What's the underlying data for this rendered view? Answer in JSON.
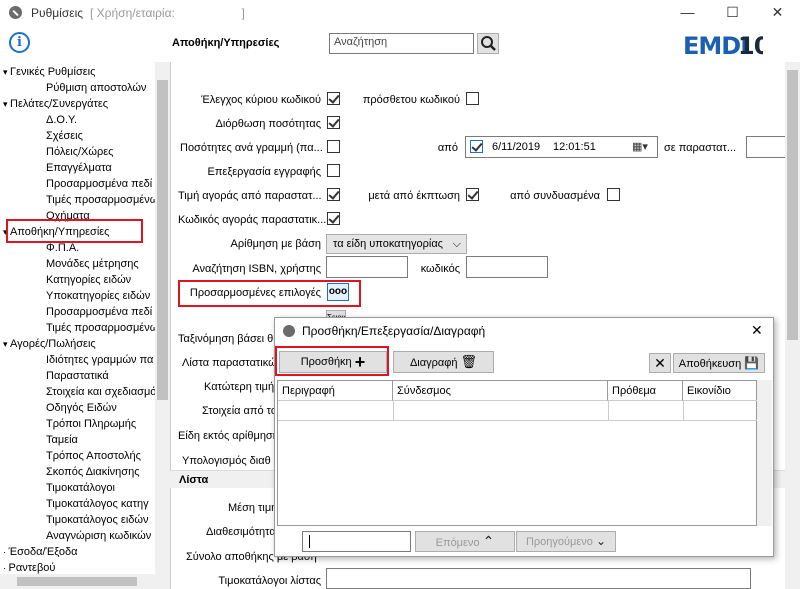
{
  "window": {
    "title": "Ρυθμίσεις",
    "subtitle": "[ Χρήση/εταιρία:                    ]",
    "minimize": "—",
    "maximize": "☐",
    "close": "✕"
  },
  "toolbar": {
    "section_label": "Αποθήκη/Υπηρεσίες",
    "search_placeholder": "Αναζήτηση",
    "logo": "EMDI10",
    "logo_color": "#1a5fb4"
  },
  "tree": {
    "items": [
      {
        "label": "Γενικές Ρυθμίσεις",
        "level": 0,
        "expanded": true
      },
      {
        "label": "Ρύθμιση αποστολών",
        "level": 1
      },
      {
        "label": "Πελάτες/Συνεργάτες",
        "level": 0,
        "expanded": true
      },
      {
        "label": "Δ.Ο.Υ.",
        "level": 1
      },
      {
        "label": "Σχέσεις",
        "level": 1
      },
      {
        "label": "Πόλεις/Χώρες",
        "level": 1
      },
      {
        "label": "Επαγγέλματα",
        "level": 1
      },
      {
        "label": "Προσαρμοσμένα πεδί",
        "level": 1
      },
      {
        "label": "Τιμές προσαρμοσμένω",
        "level": 1
      },
      {
        "label": "Οχήματα",
        "level": 1
      },
      {
        "label": "Αποθήκη/Υπηρεσίες",
        "level": 0,
        "expanded": true
      },
      {
        "label": "Φ.Π.Α.",
        "level": 1
      },
      {
        "label": "Μονάδες μέτρησης",
        "level": 1
      },
      {
        "label": "Κατηγορίες ειδών",
        "level": 1
      },
      {
        "label": "Υποκατηγορίες ειδών",
        "level": 1
      },
      {
        "label": "Προσαρμοσμένα πεδί",
        "level": 1
      },
      {
        "label": "Τιμές προσαρμοσμένω",
        "level": 1
      },
      {
        "label": "Αγορές/Πωλήσεις",
        "level": 0,
        "expanded": true
      },
      {
        "label": "Ιδιότητες γραμμών πα",
        "level": 1
      },
      {
        "label": "Παραστατικά",
        "level": 1
      },
      {
        "label": "Στοιχεία και σχεδιασμό",
        "level": 1
      },
      {
        "label": "Οδηγός Ειδών",
        "level": 1
      },
      {
        "label": "Τρόποι Πληρωμής",
        "level": 1
      },
      {
        "label": "Ταμεία",
        "level": 1
      },
      {
        "label": "Τρόπος Αποστολής",
        "level": 1
      },
      {
        "label": "Σκοπός Διακίνησης",
        "level": 1
      },
      {
        "label": "Τιμοκατάλογοι",
        "level": 1
      },
      {
        "label": "Τιμοκατάλογος κατηγ",
        "level": 1
      },
      {
        "label": "Τιμοκατάλογος ειδών",
        "level": 1
      },
      {
        "label": "Αναγνώριση κωδικών",
        "level": 1
      },
      {
        "label": "Έσοδα/Έξοδα",
        "level": 0
      },
      {
        "label": "Ραντεβού",
        "level": 0
      }
    ]
  },
  "form": {
    "main_code_check": "Έλεγχος κύριου κωδικού",
    "extra_code": "πρόσθετου κωδικού",
    "qty_correction": "Διόρθωση ποσότητας",
    "qty_per_line": "Ποσότητες ανά γραμμή (πα...",
    "from": "από",
    "date": "6/11/2019",
    "time": "12:01:51",
    "in_doc": "σε παραστατ...",
    "record_processing": "Επεξεργασία εγγραφής",
    "purchase_price": "Τιμή αγοράς από παραστατ...",
    "after_discount": "μετά από έκπτωση",
    "from_combined": "από συνδυασμένα",
    "purchase_code": "Κωδικός αγοράς παραστατικ...",
    "numbering": "Αρίθμηση με βάση",
    "numbering_value": "τα είδη υποκατηγορίας",
    "isbn": "Αναζήτηση ISBN, χρήστης",
    "code": "κωδικός",
    "custom_options": "Προσαρμοσμένες επιλογές",
    "custom_btn": "ooo",
    "serials": "Σειριακοί",
    "sort_by": "Ταξινόμηση βάσει θ",
    "doc_list": "Λίστα παραστατικώ",
    "min_price": "Κατώτερη τιμή",
    "data_from": "Στοιχεία από τα",
    "items_out": "Είδη εκτός αρίθμηση",
    "calc": "Υπολογισμός διαθ",
    "list_header": "Λίστα",
    "avg_price": "Μέση τιμή",
    "availability": "Διαθεσιμότητα",
    "warehouse_total": "Σύνολο αποθήκης με βάση",
    "price_lists": "Τιμοκατάλογοι λίστας"
  },
  "dialog": {
    "title": "Προσθήκη/Επεξεργασία/Διαγραφή",
    "close": "✕",
    "add": "Προσθήκη",
    "delete": "Διαγραφή",
    "cancel_icon": "✕",
    "save": "Αποθήκευση",
    "columns": [
      "Περιγραφή",
      "Σύνδεσμος",
      "Πρόθεμα",
      "Εικονίδιο"
    ],
    "next": "Επόμενο",
    "prev": "Προηγούμενο"
  },
  "colors": {
    "highlight_red": "#e0141e",
    "accent_blue": "#1a6fd0"
  }
}
